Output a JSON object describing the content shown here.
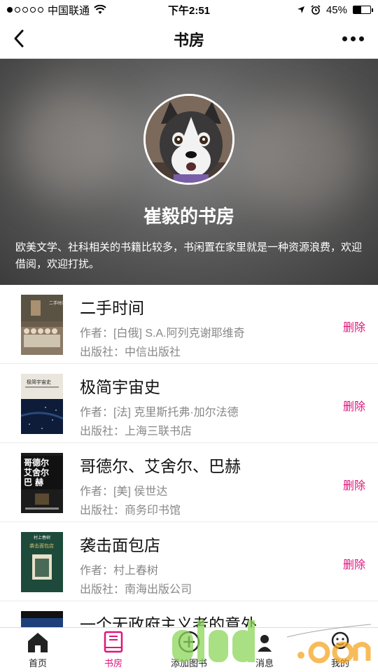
{
  "status_bar": {
    "carrier": "中国联通",
    "time": "下午2:51",
    "battery": "45%",
    "battery_level": 0.45
  },
  "nav": {
    "title": "书房"
  },
  "hero": {
    "title": "崔毅的书房",
    "description": "欧美文学、社科相关的书籍比较多，书闲置在家里就是一种资源浪费，欢迎借阅，欢迎打扰。"
  },
  "books": [
    {
      "title": "二手时间",
      "author": "作者：[白俄] S.A.阿列克谢耶维奇",
      "publisher": "出版社：中信出版社",
      "delete_label": "删除"
    },
    {
      "title": "极简宇宙史",
      "author": "作者：[法] 克里斯托弗·加尔法德",
      "publisher": "出版社：上海三联书店",
      "delete_label": "删除"
    },
    {
      "title": "哥德尔、艾舍尔、巴赫",
      "author": "作者：[美] 侯世达",
      "publisher": "出版社：商务印书馆",
      "delete_label": "删除"
    },
    {
      "title": "袭击面包店",
      "author": "作者：村上春树",
      "publisher": "出版社：南海出版公司",
      "delete_label": "删除"
    },
    {
      "title": "一个无政府主义者的意外..."
    }
  ],
  "covers": {
    "c2_line1": "极简宇宙史",
    "c3_line1": "哥德尔",
    "c3_line2": "艾舍尔",
    "c3_line3": "巴 赫",
    "c4_author": "村上春树",
    "c4_title": "袭击面包店"
  },
  "tabs": [
    {
      "label": "首页",
      "icon": "home-icon"
    },
    {
      "label": "书房",
      "icon": "book-icon"
    },
    {
      "label": "添加图书",
      "icon": "add-icon"
    },
    {
      "label": "消息",
      "icon": "message-icon"
    },
    {
      "label": "我的",
      "icon": "user-icon"
    }
  ],
  "colors": {
    "accent": "#e0157c"
  }
}
